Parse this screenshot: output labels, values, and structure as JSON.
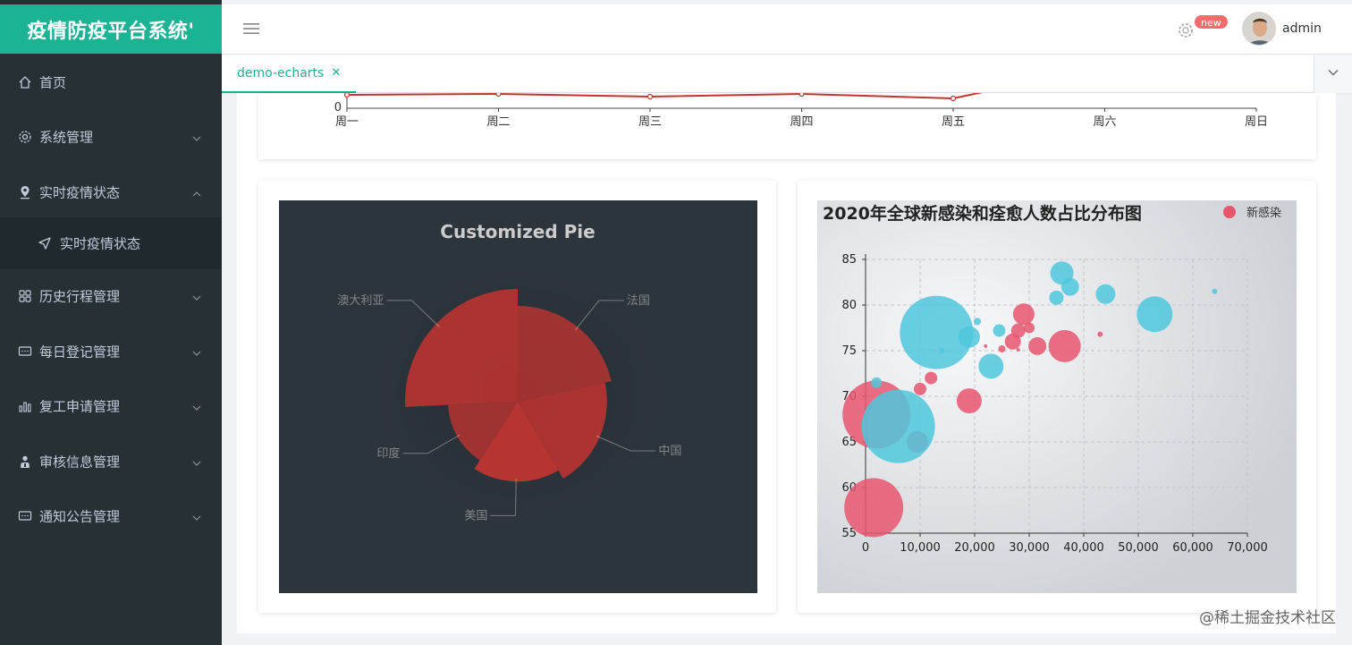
{
  "app": {
    "title": "疫情防疫平台系统'"
  },
  "sidebar": {
    "items": [
      {
        "label": "首页",
        "icon": "home-icon"
      },
      {
        "label": "系统管理",
        "icon": "gear-icon"
      },
      {
        "label": "实时疫情状态",
        "icon": "location-pin-icon",
        "expanded": true
      },
      {
        "label": "实时疫情状态",
        "icon": "navigation-arrow-icon",
        "submenu": true
      },
      {
        "label": "历史行程管理",
        "icon": "grid-icon"
      },
      {
        "label": "每日登记管理",
        "icon": "message-icon"
      },
      {
        "label": "复工申请管理",
        "icon": "bar-chart-icon"
      },
      {
        "label": "审核信息管理",
        "icon": "user-badge-icon"
      },
      {
        "label": "通知公告管理",
        "icon": "message-icon"
      }
    ]
  },
  "header": {
    "badge": "new",
    "username": "admin"
  },
  "tabs": [
    {
      "label": "demo-echarts",
      "active": true
    }
  ],
  "line_chart": {
    "chart_data": {
      "type": "line",
      "categories": [
        "周一",
        "周二",
        "周三",
        "周四",
        "周五",
        "周六",
        "周日"
      ],
      "visible_ytick": "0",
      "color": "#c23531"
    }
  },
  "pie_chart": {
    "chart_data": {
      "type": "pie",
      "title": "Customized Pie",
      "slices": [
        {
          "name": "法国",
          "value": 335
        },
        {
          "name": "中国",
          "value": 310
        },
        {
          "name": "美国",
          "value": 274
        },
        {
          "name": "印度",
          "value": 235
        },
        {
          "name": "澳大利亚",
          "value": 400
        }
      ],
      "rose_type": "radius",
      "color": "#c23531",
      "background": "#2c343c"
    }
  },
  "bubble_chart": {
    "chart_data": {
      "type": "scatter",
      "title": "2020年全球新感染和痊愈人数占比分布图",
      "legend": [
        "新感染"
      ],
      "colors": {
        "red": "#e8566e",
        "cyan": "#4fc7dc"
      },
      "xlim": [
        0,
        70000
      ],
      "ylim": [
        55,
        85
      ],
      "xticks": [
        "0",
        "10,000",
        "20,000",
        "30,000",
        "40,000",
        "50,000",
        "60,000",
        "70,000"
      ],
      "yticks": [
        "55",
        "60",
        "65",
        "70",
        "75",
        "80",
        "85"
      ],
      "series": [
        {
          "name": "新感染",
          "points": [
            [
              2000,
              68
            ],
            [
              1500,
              57.8
            ],
            [
              9500,
              65
            ],
            [
              10000,
              70.8
            ],
            [
              12000,
              72
            ],
            [
              19000,
              69.5
            ],
            [
              29000,
              79
            ],
            [
              27000,
              76
            ],
            [
              31500,
              75.5
            ],
            [
              36500,
              75.5
            ],
            [
              28000,
              77.2
            ],
            [
              30000,
              77.5
            ],
            [
              25000,
              75.2
            ],
            [
              43000,
              76.8
            ],
            [
              22000,
              75.5
            ],
            [
              28000,
              75.1
            ]
          ],
          "sizes": [
            38,
            33,
            12,
            7,
            7,
            14,
            12,
            9,
            10,
            18,
            8,
            6,
            4,
            3,
            2,
            2
          ]
        },
        {
          "name": "",
          "points": [
            [
              13000,
              77
            ],
            [
              6000,
              66.7
            ],
            [
              2000,
              71.5
            ],
            [
              19000,
              76.5
            ],
            [
              23000,
              73.3
            ],
            [
              24500,
              77.2
            ],
            [
              20500,
              78.2
            ],
            [
              36000,
              83.5
            ],
            [
              37500,
              82
            ],
            [
              35000,
              80.8
            ],
            [
              44000,
              81.2
            ],
            [
              53000,
              79
            ],
            [
              64000,
              81.5
            ],
            [
              14000,
              75
            ]
          ],
          "sizes": [
            41,
            41,
            6,
            12,
            14,
            7,
            4,
            13,
            10,
            8,
            11,
            20,
            3,
            3
          ]
        }
      ]
    }
  },
  "watermark": "@稀土掘金技术社区"
}
